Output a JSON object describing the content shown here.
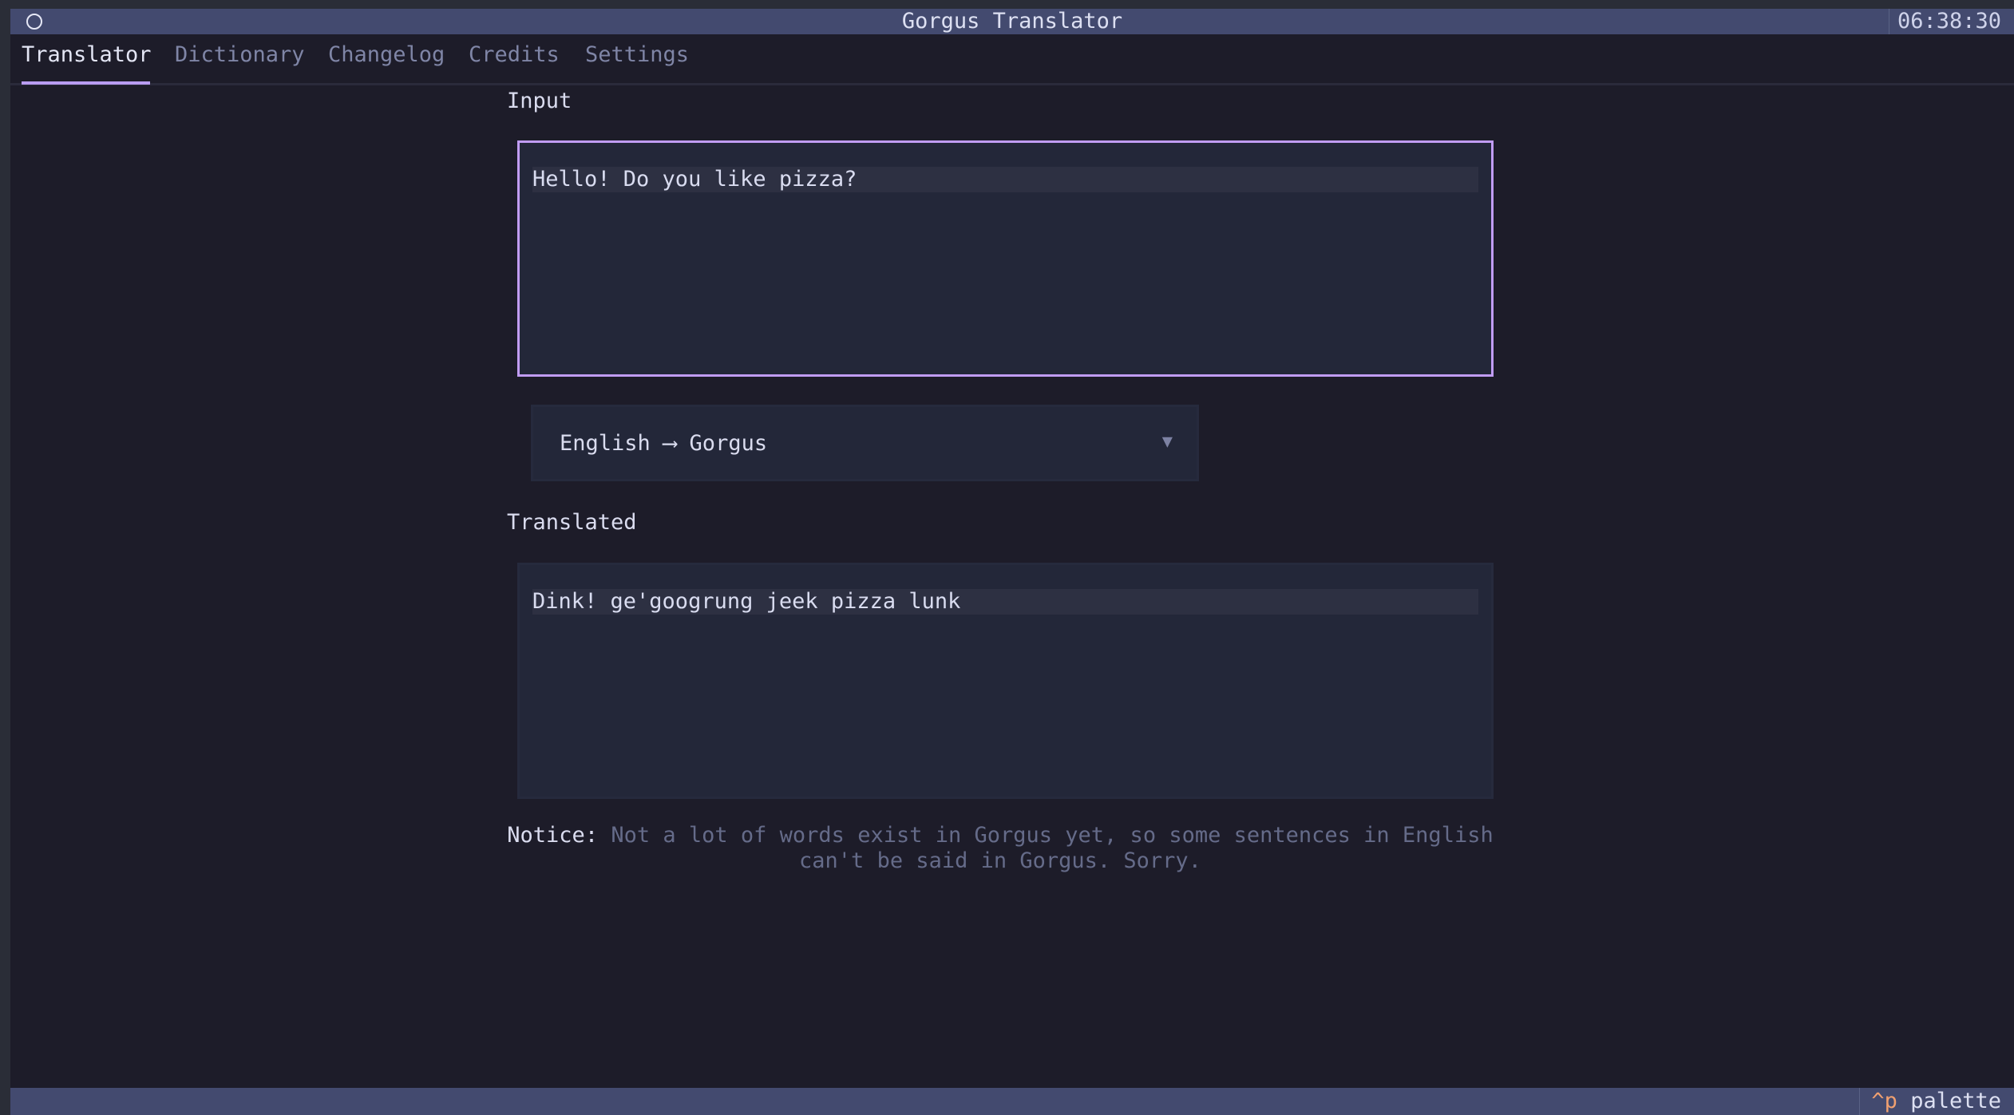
{
  "window": {
    "title": "Gorgus Translator",
    "clock": "06:38:30"
  },
  "tabs": [
    {
      "label": "Translator",
      "active": true
    },
    {
      "label": "Dictionary",
      "active": false
    },
    {
      "label": "Changelog",
      "active": false
    },
    {
      "label": "Credits",
      "active": false
    },
    {
      "label": "Settings",
      "active": false
    }
  ],
  "input": {
    "label": "Input",
    "value": "Hello! Do you like pizza?"
  },
  "language_select": {
    "value": "English ⟶ Gorgus",
    "caret_icon": "triangle-down-icon"
  },
  "translated": {
    "label": "Translated",
    "value": "Dink! ge'googrung jeek pizza lunk"
  },
  "notice": {
    "label": "Notice:",
    "text": "Not a lot of words exist in Gorgus yet, so some sentences in English can't be said in Gorgus. Sorry."
  },
  "footer": {
    "key": "^p",
    "label": "palette"
  },
  "colors": {
    "accent": "#b99cf2",
    "background": "#1d1c29",
    "bar": "#434a6f",
    "panel": "#232739",
    "hotkey": "#f0a070"
  }
}
